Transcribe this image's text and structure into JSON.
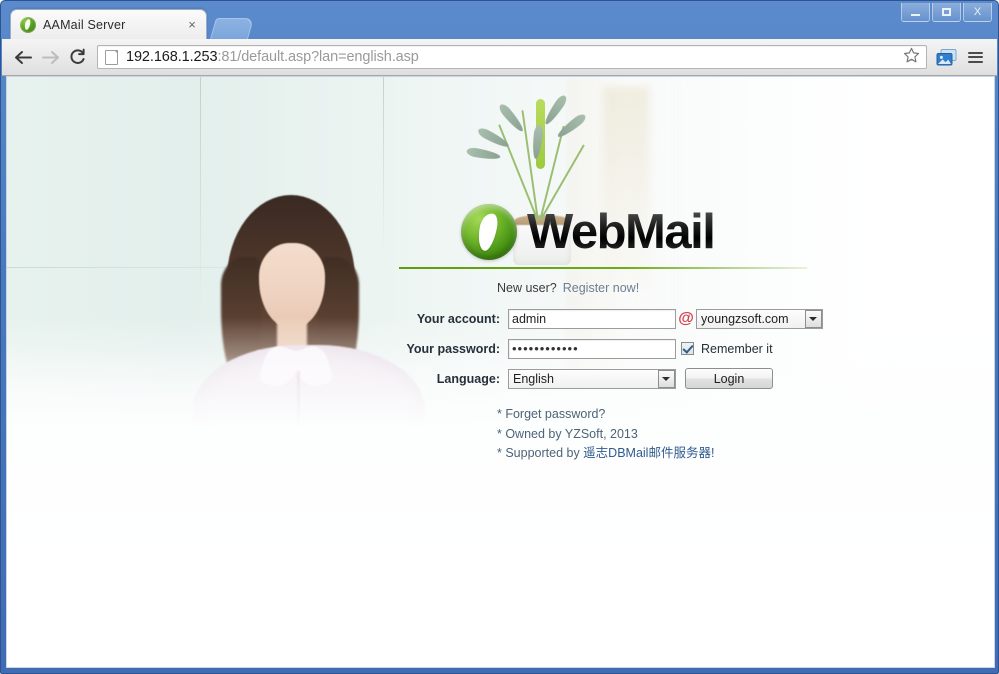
{
  "browser": {
    "tab": {
      "title": "AAMail Server",
      "favicon": "webmail-logo-icon",
      "close": "×"
    },
    "newtab_button": "new-tab-button",
    "window_controls": {
      "minimize": "minimize",
      "maximize": "maximize",
      "close": "X"
    },
    "nav": {
      "back": "back-arrow-icon",
      "forward": "forward-arrow-icon",
      "reload": "reload-icon"
    },
    "url": {
      "host": "192.168.1.253",
      "rest": ":81/default.asp?lan=english.asp",
      "full": "192.168.1.253:81/default.asp?lan=english.asp",
      "page_icon": "page-document-icon"
    },
    "toolbar_icons": {
      "bookmark": "star-icon",
      "media": "image-extension-icon",
      "menu": "hamburger-menu-icon"
    }
  },
  "page": {
    "brand": {
      "name": "WebMail",
      "mark": "webmail-logo-icon"
    },
    "new_user": {
      "prompt": "New user?",
      "link": "Register now!"
    },
    "form": {
      "account": {
        "label": "Your account:",
        "value": "admin",
        "placeholder": ""
      },
      "at_symbol": "@",
      "domain": {
        "selected": "youngzsoft.com"
      },
      "password": {
        "label": "Your password:",
        "value": "••••••••••••",
        "placeholder": ""
      },
      "remember": {
        "label": "Remember it",
        "checked": true
      },
      "language": {
        "label": "Language:",
        "selected": "English"
      },
      "login_button": "Login"
    },
    "links": [
      "* Forget password?",
      "* Owned by YZSoft, 2013"
    ],
    "supported": {
      "prefix": "* Supported by ",
      "vendor": "遥志DBMail邮件服务器!"
    }
  },
  "colors": {
    "brand_green": "#5e9c10",
    "at_red": "#d0414b",
    "link_blue": "#4e6377",
    "window_blue": "#4a79bd"
  }
}
